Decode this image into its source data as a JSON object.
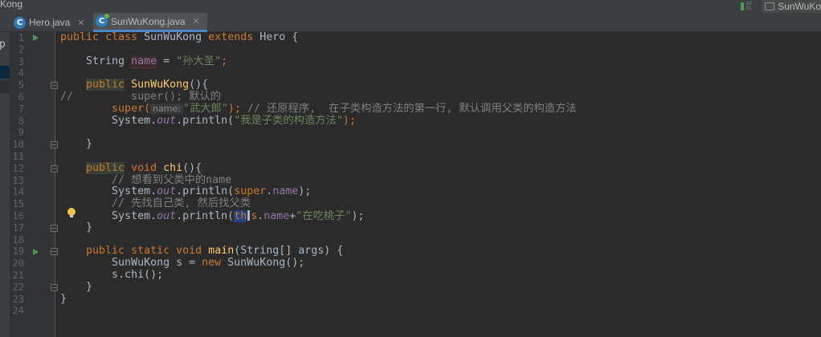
{
  "window": {
    "title": "Kong",
    "right_tab_label": "SunWuKo",
    "branch_badge_text": "10\n01"
  },
  "tabs": [
    {
      "label": "Hero.java",
      "icon": "class-c-icon",
      "active": false
    },
    {
      "label": "SunWuKong.java",
      "icon": "class-c-icon",
      "active": true
    }
  ],
  "left_strip": {
    "letter": "p"
  },
  "gutter": {
    "line_numbers": [
      "1",
      "2",
      "3",
      "4",
      "5",
      "6",
      "7",
      "8",
      "9",
      "10",
      "11",
      "12",
      "13",
      "14",
      "15",
      "16",
      "17",
      "18",
      "19",
      "20",
      "21",
      "22",
      "23",
      "24"
    ]
  },
  "code": {
    "l1": {
      "kw1": "public",
      "kw2": "class",
      "name": "SunWuKong",
      "kw3": "extends",
      "rest": "Hero {"
    },
    "l3": {
      "type": "String",
      "field": "name",
      "eq": " = ",
      "value": "\"孙大圣\"",
      "end": ";"
    },
    "l5": {
      "kw": "public",
      "fn": "SunWuKong",
      "rest": "(){"
    },
    "l6": {
      "comment": "//         super(); 默认的"
    },
    "l7": {
      "call": "super(",
      "hint": "name:",
      "value": "\"武大郎\"",
      "end": ");",
      "comment": "// 还原程序,  在子类构造方法的第一行, 默认调用父类的构造方法"
    },
    "l8": {
      "sys": "System.",
      "out": "out",
      "call": ".println(",
      "value": "\"我是子类的构造方法\"",
      "end": ");"
    },
    "l10": {
      "brace": "}"
    },
    "l12": {
      "kw": "public",
      "kw2": "void",
      "fn": "chi",
      "rest": "(){"
    },
    "l13": {
      "comment": "// 想看到父类中的name"
    },
    "l14": {
      "sys": "System.",
      "out": "out",
      "call": ".println(",
      "kw": "super",
      "dot": ".",
      "field": "name",
      "end": ");"
    },
    "l15": {
      "comment": "// 先找自己类, 然后找父类"
    },
    "l16": {
      "sys": "System.",
      "out": "out",
      "call": ".println(",
      "this1": "th",
      "this2": "s",
      "dot": ".",
      "field": "name",
      "plus": "+",
      "value": "\"在吃桃子\"",
      "end": ");"
    },
    "l17": {
      "brace": "}"
    },
    "l19": {
      "kw1": "public",
      "kw2": "static",
      "kw3": "void",
      "fn": "main",
      "rest": "(String[] args) {"
    },
    "l20": {
      "type": "SunWuKong s = ",
      "kw": "new",
      "rest": " SunWuKong();"
    },
    "l21": {
      "text": "s.chi();"
    },
    "l22": {
      "brace": "}"
    },
    "l23": {
      "brace": "}"
    }
  }
}
